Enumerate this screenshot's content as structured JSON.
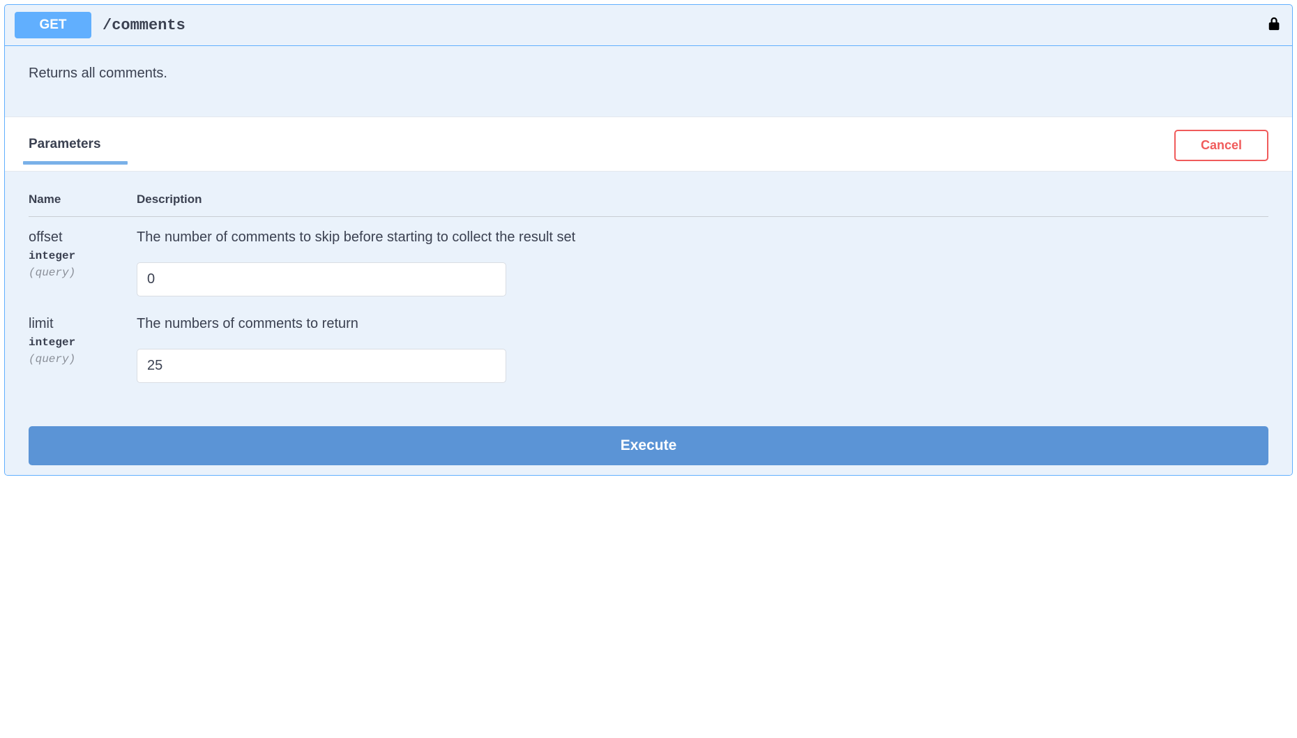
{
  "operation": {
    "method": "GET",
    "path": "/comments",
    "description": "Returns all comments."
  },
  "tabs": {
    "parameters_label": "Parameters",
    "cancel_label": "Cancel"
  },
  "columns": {
    "name": "Name",
    "description": "Description"
  },
  "parameters": [
    {
      "name": "offset",
      "type": "integer",
      "in": "(query)",
      "description": "The number of comments to skip before starting to collect the result set",
      "value": "0"
    },
    {
      "name": "limit",
      "type": "integer",
      "in": "(query)",
      "description": "The numbers of comments to return",
      "value": "25"
    }
  ],
  "actions": {
    "execute_label": "Execute"
  }
}
